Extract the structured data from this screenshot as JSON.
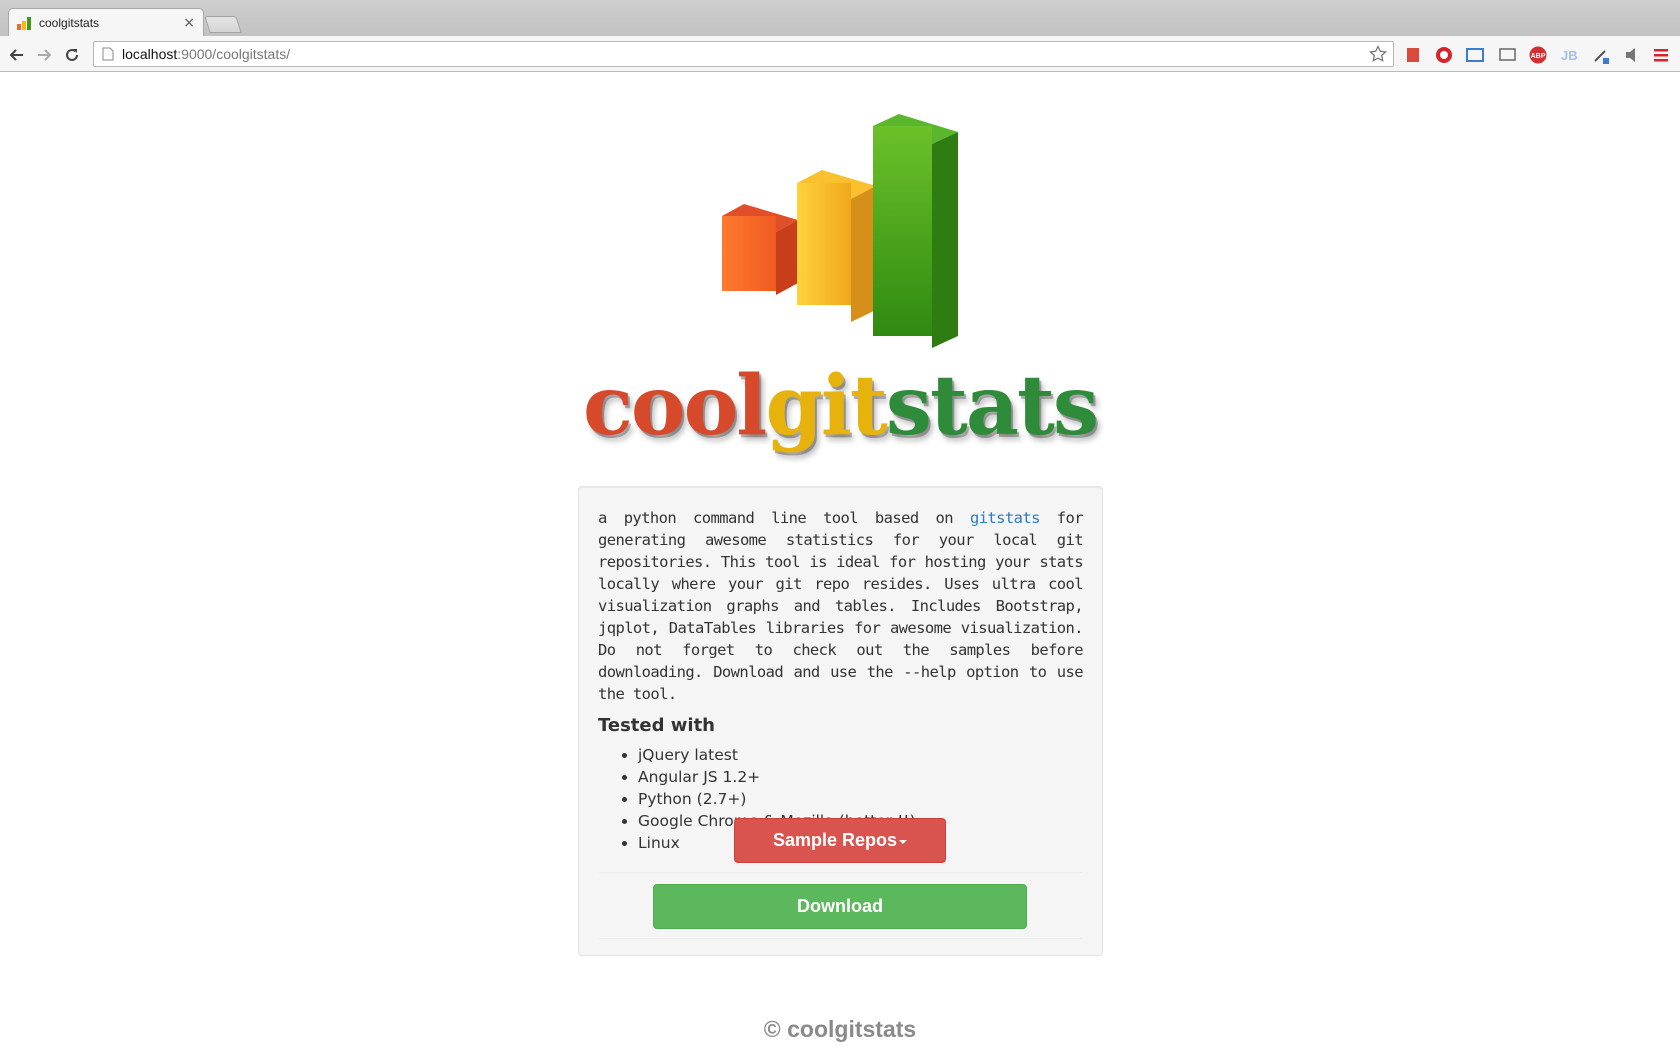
{
  "browser": {
    "tab_title": "coolgitstats",
    "tab_close": "×",
    "url_host": "localhost",
    "url_rest": ":9000/coolgitstats/"
  },
  "logo": {
    "wordmark_cool": "cool",
    "wordmark_git": "git",
    "wordmark_stats": "stats",
    "bar_colors": [
      "#ff6a2c",
      "#f7b51e",
      "#3f9a1d"
    ]
  },
  "main": {
    "desc_before_link": "a python command line tool based on ",
    "desc_link": "gitstats",
    "desc_after_link": " for generating awesome statistics for your local git repositories. This tool is ideal for hosting your stats locally where your git repo resides. Uses ultra cool visualization graphs and tables. Includes Bootstrap, jqplot, DataTables libraries for awesome visualization. Do not forget to check out the samples before downloading. Download and use the --help option to use the tool.",
    "tested_heading": "Tested with",
    "tested_items": [
      "jQuery latest",
      "Angular JS 1.2+",
      "Python (2.7+)",
      "Google Chrome & Mozilla (better !!)",
      "Linux"
    ],
    "sample_button": "Sample Repos",
    "download_button": "Download"
  },
  "footer": {
    "text": "© coolgitstats"
  },
  "colors": {
    "link": "#2f7bbd",
    "danger": "#d9534f",
    "success": "#5cb85c"
  }
}
